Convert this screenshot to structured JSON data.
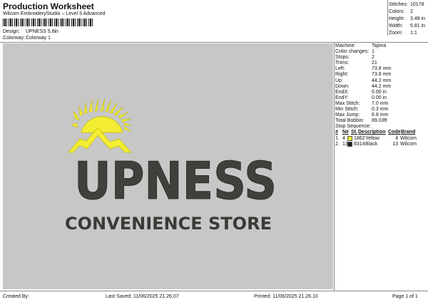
{
  "header": {
    "title": "Production Worksheet",
    "software": "Wilcom EmbroideryStudio – Level 3 Advanced",
    "design_label": "Design:",
    "design_value": "UPNESS 5,8in",
    "colorway_label": "Colorway:",
    "colorway_value": "Colorway 1"
  },
  "summary": [
    {
      "k": "Stitches:",
      "v": "10178"
    },
    {
      "k": "Colors:",
      "v": "2"
    },
    {
      "k": "Height:",
      "v": "3.48 in"
    },
    {
      "k": "Width:",
      "v": "5.81 in"
    },
    {
      "k": "Zoom:",
      "v": "1:1"
    }
  ],
  "design": {
    "brand": "UPNESS",
    "tagline": "CONVENIENCE STORE",
    "colors": {
      "yellow": "#f3ee33",
      "black": "#3a3a36",
      "background": "#c7c7c7"
    }
  },
  "info": [
    {
      "k": "Machine:",
      "v": "Tajima"
    },
    {
      "k": "Color changes:",
      "v": "1"
    },
    {
      "k": "Stops:",
      "v": "2"
    },
    {
      "k": "Trims:",
      "v": "21"
    },
    {
      "k": "Left:",
      "v": "73.8 mm"
    },
    {
      "k": "Right:",
      "v": "73.8 mm"
    },
    {
      "k": "Up:",
      "v": "44.2 mm"
    },
    {
      "k": "Down:",
      "v": "44.2 mm"
    },
    {
      "k": "EndX:",
      "v": "0.00 in"
    },
    {
      "k": "EndY:",
      "v": "0.00 in"
    },
    {
      "k": "Max Stitch:",
      "v": "7.0 mm"
    },
    {
      "k": "Min Stitch:",
      "v": "0.3 mm"
    },
    {
      "k": "Max Jump:",
      "v": "6.8 mm"
    },
    {
      "k": "Total Bobbin:",
      "v": "89.03ft"
    }
  ],
  "stops": {
    "title": "Stop Sequence:",
    "headers": [
      "#",
      "N#",
      "St.",
      "Description",
      "Code",
      "Brand"
    ],
    "rows": [
      {
        "num": "1.",
        "n": "4",
        "st": "1862",
        "desc": "Yellow",
        "code": "4",
        "brand": "Wilcom",
        "color": "#f3ee33"
      },
      {
        "num": "2.",
        "n": "13",
        "st": "8314",
        "desc": "Black",
        "code": "13",
        "brand": "Wilcom",
        "color": "#1f1f1f"
      }
    ]
  },
  "footer": {
    "created_by": "Created By:",
    "last_saved": "Last Saved: 11/06/2025 21.26.07",
    "printed": "Printed: 11/06/2025 21.26.10",
    "page": "Page 1 of 1"
  }
}
